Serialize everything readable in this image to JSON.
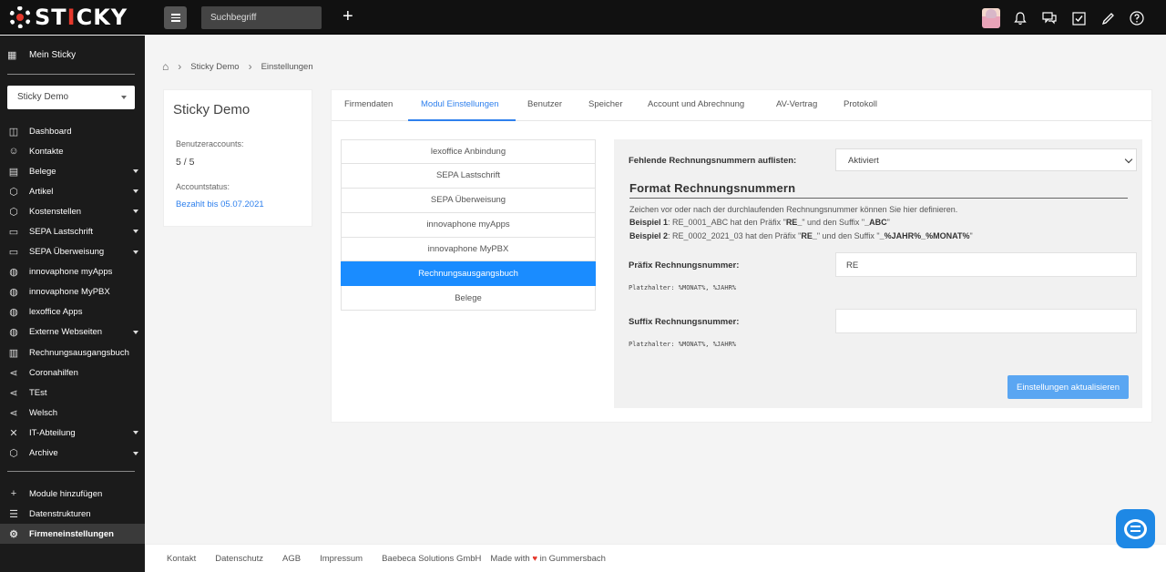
{
  "app": {
    "logo_text": "STICKY"
  },
  "topbar": {
    "search_placeholder": "Suchbegriff",
    "add_label": "+"
  },
  "sidebar": {
    "mein_sticky": "Mein Sticky",
    "company": "Sticky Demo",
    "items": [
      {
        "label": "Dashboard",
        "icon": "dashboard-icon",
        "chevron": false
      },
      {
        "label": "Kontakte",
        "icon": "contacts-icon",
        "chevron": false
      },
      {
        "label": "Belege",
        "icon": "document-icon",
        "chevron": true
      },
      {
        "label": "Artikel",
        "icon": "box-icon",
        "chevron": true
      },
      {
        "label": "Kostenstellen",
        "icon": "box-icon",
        "chevron": true
      },
      {
        "label": "SEPA Lastschrift",
        "icon": "card-icon",
        "chevron": true
      },
      {
        "label": "SEPA Überweisung",
        "icon": "card-icon",
        "chevron": true
      },
      {
        "label": "innovaphone myApps",
        "icon": "globe-icon",
        "chevron": false
      },
      {
        "label": "innovaphone MyPBX",
        "icon": "globe-icon",
        "chevron": false
      },
      {
        "label": "lexoffice Apps",
        "icon": "globe-icon",
        "chevron": false
      },
      {
        "label": "Externe Webseiten",
        "icon": "globe-icon",
        "chevron": true
      },
      {
        "label": "Rechnungsausgangsbuch",
        "icon": "ledger-icon",
        "chevron": false
      },
      {
        "label": "Coronahilfen",
        "icon": "share-icon",
        "chevron": false
      },
      {
        "label": "TEst",
        "icon": "share-icon",
        "chevron": false
      },
      {
        "label": "Welsch",
        "icon": "share-icon",
        "chevron": false
      },
      {
        "label": "IT-Abteilung",
        "icon": "tools-icon",
        "chevron": true
      },
      {
        "label": "Archive",
        "icon": "box-icon",
        "chevron": true
      }
    ],
    "bottom": [
      {
        "label": "Module hinzufügen",
        "icon": "plus-icon",
        "active": false
      },
      {
        "label": "Datenstrukturen",
        "icon": "database-icon",
        "active": false
      },
      {
        "label": "Firmeneinstellungen",
        "icon": "gear-icon",
        "active": true
      }
    ]
  },
  "breadcrumb": {
    "items": [
      "Sticky Demo",
      "Einstellungen"
    ]
  },
  "account_card": {
    "title": "Sticky Demo",
    "users_label": "Benutzeraccounts:",
    "users_value": "5 / 5",
    "status_label": "Accountstatus:",
    "status_value": "Bezahlt bis 05.07.2021"
  },
  "tabs": [
    {
      "label": "Firmendaten",
      "active": false
    },
    {
      "label": "Modul Einstellungen",
      "active": true
    },
    {
      "label": "Benutzer",
      "active": false
    },
    {
      "label": "Speicher",
      "active": false
    },
    {
      "label": "Account und Abrechnung",
      "active": false
    },
    {
      "label": "AV-Vertrag",
      "active": false
    },
    {
      "label": "Protokoll",
      "active": false
    }
  ],
  "modules": [
    {
      "label": "lexoffice Anbindung",
      "active": false
    },
    {
      "label": "SEPA Lastschrift",
      "active": false
    },
    {
      "label": "SEPA Überweisung",
      "active": false
    },
    {
      "label": "innovaphone myApps",
      "active": false
    },
    {
      "label": "innovaphone MyPBX",
      "active": false
    },
    {
      "label": "Rechnungsausgangsbuch",
      "active": true
    },
    {
      "label": "Belege",
      "active": false
    }
  ],
  "settings": {
    "missing_label": "Fehlende Rechnungsnummern auflisten:",
    "missing_value": "Aktiviert",
    "format_title": "Format Rechnungsnummern",
    "desc_line": "Zeichen vor oder nach der durchlaufenden Rechnungsnummer können Sie hier definieren.",
    "example1_prefix": "Beispiel 1",
    "example1_text_a": ": RE_0001_ABC hat den Präfix \"",
    "example1_bold_a": "RE_",
    "example1_text_b": "\" und den Suffix \"",
    "example1_bold_b": "_ABC",
    "example1_text_c": "\"",
    "example2_prefix": "Beispiel 2",
    "example2_text_a": ": RE_0002_2021_03 hat den Präfix \"",
    "example2_bold_a": "RE_",
    "example2_text_b": "\" und den Suffix \"",
    "example2_bold_b": "_%JAHR%_%MONAT%",
    "example2_text_c": "\"",
    "prefix_label": "Präfix Rechnungsnummer:",
    "prefix_value": "RE",
    "prefix_hint": "Platzhalter: %MONAT%, %JAHR%",
    "suffix_label": "Suffix Rechnungsnummer:",
    "suffix_value": "",
    "suffix_hint": "Platzhalter: %MONAT%, %JAHR%",
    "update_button": "Einstellungen aktualisieren"
  },
  "footer": {
    "links": [
      "Kontakt",
      "Datenschutz",
      "AGB",
      "Impressum",
      "Baebeca Solutions GmbH"
    ],
    "made_with_a": "Made with",
    "made_with_b": "in Gummersbach"
  },
  "colors": {
    "accent": "#2f80ed",
    "active_module": "#1a8cff",
    "logo_red": "#e5382c",
    "sidebar_bg": "#1b1b1b"
  }
}
